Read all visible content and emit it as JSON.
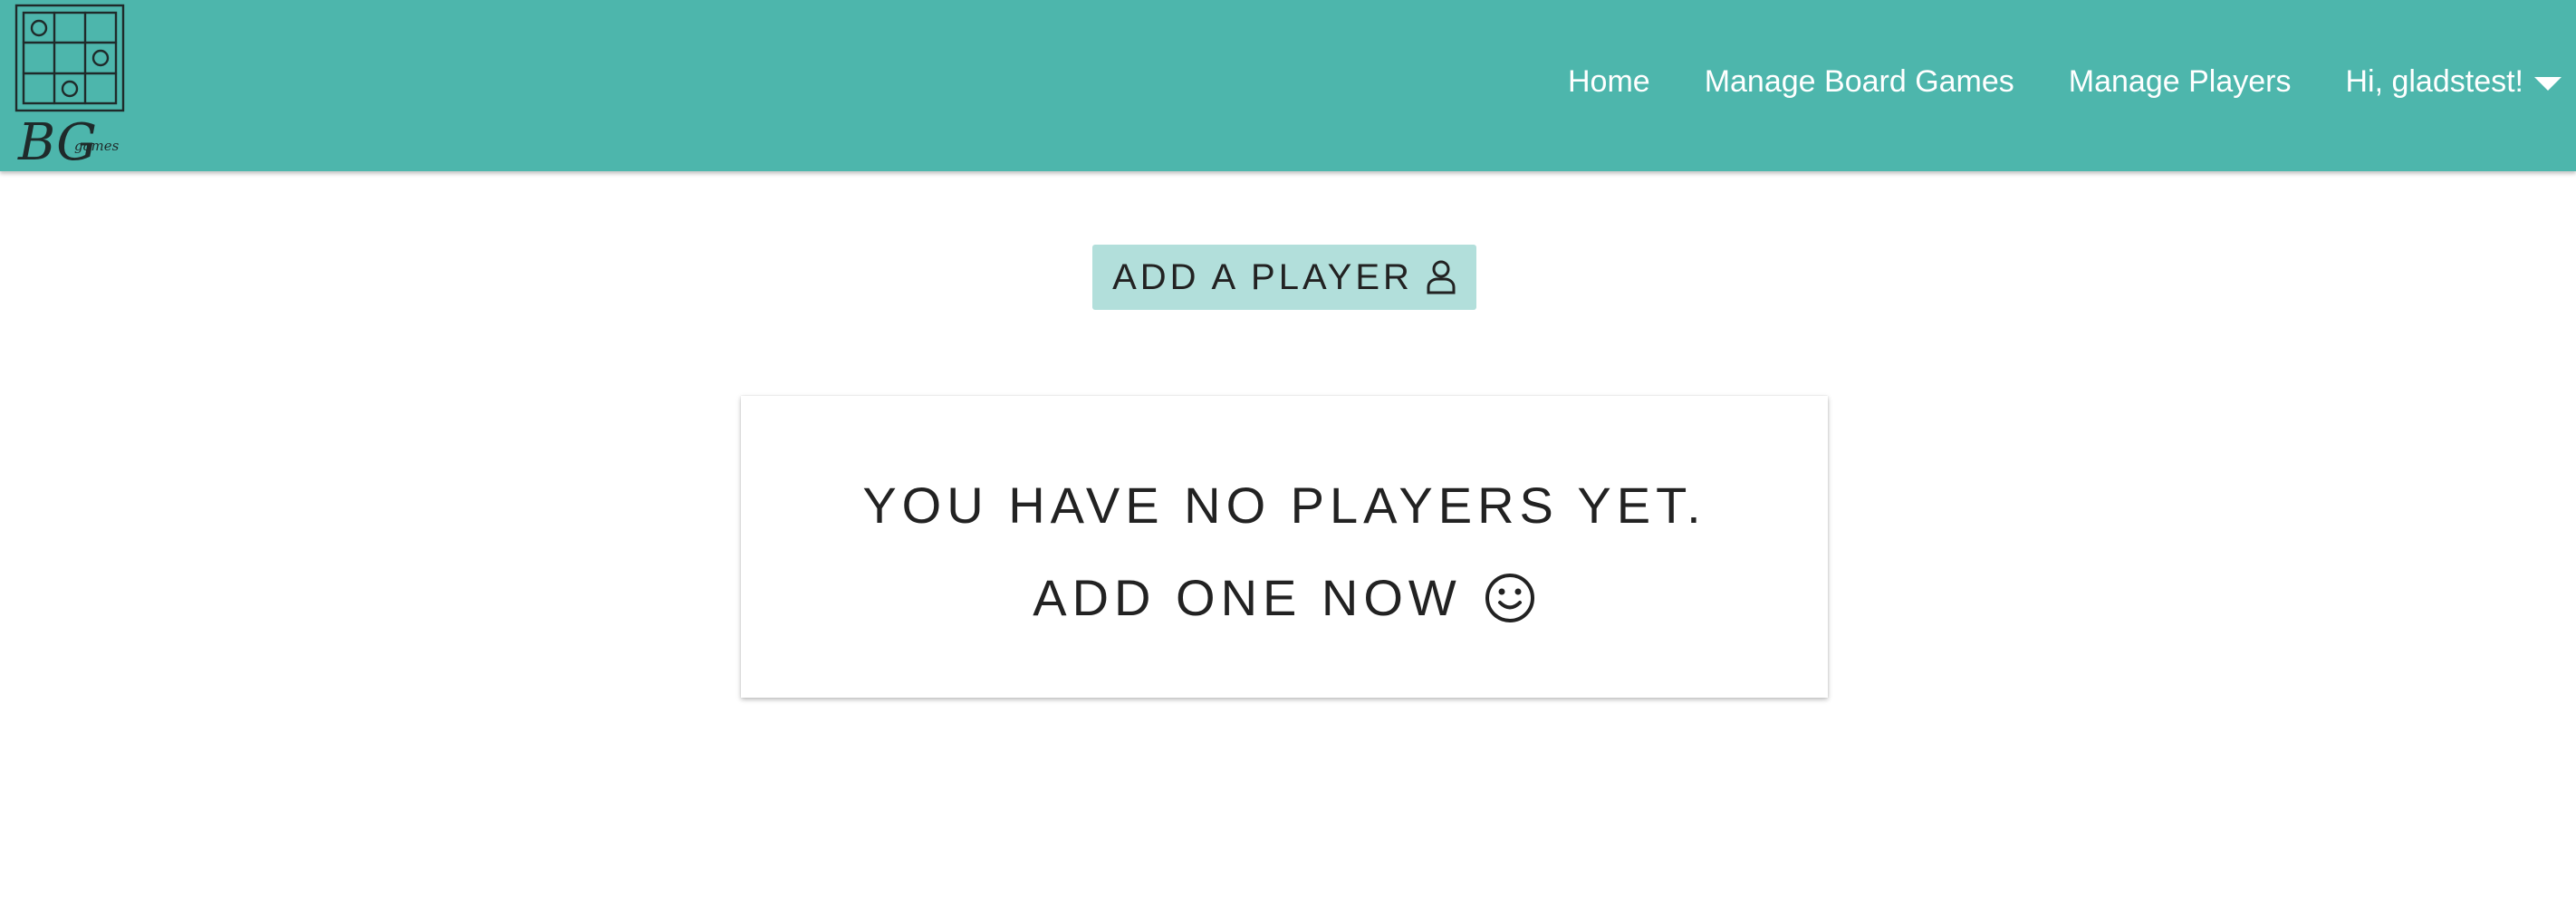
{
  "header": {
    "logo": {
      "name": "bg-games-logo",
      "text": "BG",
      "subtext": "games"
    },
    "nav": [
      {
        "label": "Home"
      },
      {
        "label": "Manage Board Games"
      },
      {
        "label": "Manage Players"
      }
    ],
    "user_menu": {
      "label": "Hi, gladstest!",
      "icon": "caret-down-icon"
    }
  },
  "main": {
    "add_button": {
      "label": "ADD A PLAYER",
      "icon": "user-icon"
    },
    "empty_card": {
      "line1": "YOU HAVE NO PLAYERS YET.",
      "line2": "ADD ONE NOW",
      "icon": "smiley-icon"
    }
  },
  "colors": {
    "navbar": "#4db6ac",
    "button": "#b2dfdb",
    "text": "#222222"
  }
}
